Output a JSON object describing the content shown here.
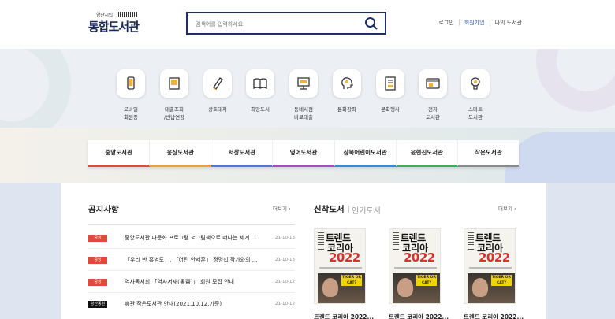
{
  "header": {
    "logo_sub": "양산시립",
    "logo_main": "통합도서관",
    "search_placeholder": "검색어를 입력하세요.",
    "nav": {
      "login": "로그인",
      "join": "회원가입",
      "mylib": "나의 도서관"
    }
  },
  "services": [
    {
      "label": "모바일\n회원증",
      "icon": "mobile-phone-icon"
    },
    {
      "label": "대출조회\n/반납연장",
      "icon": "book-icon"
    },
    {
      "label": "상호대차",
      "icon": "pencil-book-icon"
    },
    {
      "label": "희망도서",
      "icon": "open-book-icon"
    },
    {
      "label": "동네서점\n바로대출",
      "icon": "bookstore-icon"
    },
    {
      "label": "문화강좌",
      "icon": "head-idea-icon"
    },
    {
      "label": "문화행사",
      "icon": "document-icon"
    },
    {
      "label": "전자\n도서관",
      "icon": "ebook-icon"
    },
    {
      "label": "스마트\n도서관",
      "icon": "lightbulb-icon"
    }
  ],
  "library_tabs": [
    {
      "label": "중앙도서관",
      "color": "#e2493c"
    },
    {
      "label": "웅상도서관",
      "color": "#f0a23a"
    },
    {
      "label": "서창도서관",
      "color": "#5a73d8"
    },
    {
      "label": "영어도서관",
      "color": "#a54cc8"
    },
    {
      "label": "삼북어린이도서관",
      "color": "#2f8fd8"
    },
    {
      "label": "윤현진도서관",
      "color": "#3fae5a"
    },
    {
      "label": "작은도서관",
      "color": "#8a8a8a"
    }
  ],
  "notices": {
    "title": "공지사항",
    "more": "더보기",
    "items": [
      {
        "badge": "중앙",
        "badge_color": "#e2493c",
        "text": "중앙도서관 다문화 프로그램 <그림책으로 떠나는 세계 ...",
        "date": "21-10-13"
      },
      {
        "badge": "중앙",
        "badge_color": "#e2493c",
        "text": "「우리 반 홍범도」, 「어린 안세훈」 정명섭 작가와의 ...",
        "date": "21-10-13"
      },
      {
        "badge": "중앙",
        "badge_color": "#e2493c",
        "text": "역사독서회 「역사서재(書齋)」 회원 모집 안내",
        "date": "21-10-12"
      },
      {
        "badge": "양산동원",
        "badge_color": "#111111",
        "text": "휴관 작은도서관 안내(2021.10.12.기준)",
        "date": "21-10-12"
      }
    ]
  },
  "books": {
    "tab_new": "신착도서",
    "tab_popular": "인기도서",
    "more": "더보기",
    "cover": {
      "line1": "트렌드",
      "line2": "코리아",
      "year": "2022",
      "tag": "TIGER OR CAT?"
    },
    "items": [
      {
        "caption": "트렌드 코리아 2022..."
      },
      {
        "caption": "트렌드 코리아 2022..."
      },
      {
        "caption": "트렌드 코리아 2022..."
      }
    ]
  }
}
